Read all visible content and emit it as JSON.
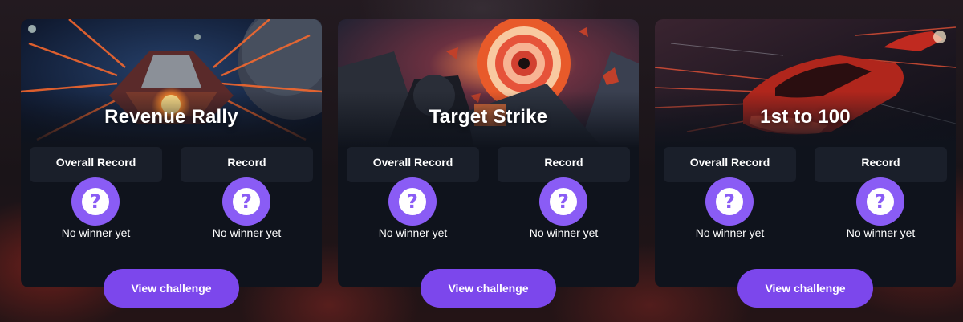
{
  "cards": [
    {
      "title": "Revenue Rally",
      "overall_record_label": "Overall Record",
      "record_label": "Record",
      "overall_winner": "No winner yet",
      "record_winner": "No winner yet",
      "cta": "View challenge",
      "unknown_glyph": "?",
      "icon": "spaceship-hero-image"
    },
    {
      "title": "Target Strike",
      "overall_record_label": "Overall Record",
      "record_label": "Record",
      "overall_winner": "No winner yet",
      "record_winner": "No winner yet",
      "cta": "View challenge",
      "unknown_glyph": "?",
      "icon": "target-explosion-hero-image"
    },
    {
      "title": "1st to 100",
      "overall_record_label": "Overall Record",
      "record_label": "Record",
      "overall_winner": "No winner yet",
      "record_winner": "No winner yet",
      "cta": "View challenge",
      "unknown_glyph": "?",
      "icon": "race-car-hero-image"
    }
  ],
  "colors": {
    "accent": "#7c47ec",
    "question_badge": "#8a5cf5",
    "card_bg": "#0f131c",
    "label_bg": "#1a1f2a"
  }
}
